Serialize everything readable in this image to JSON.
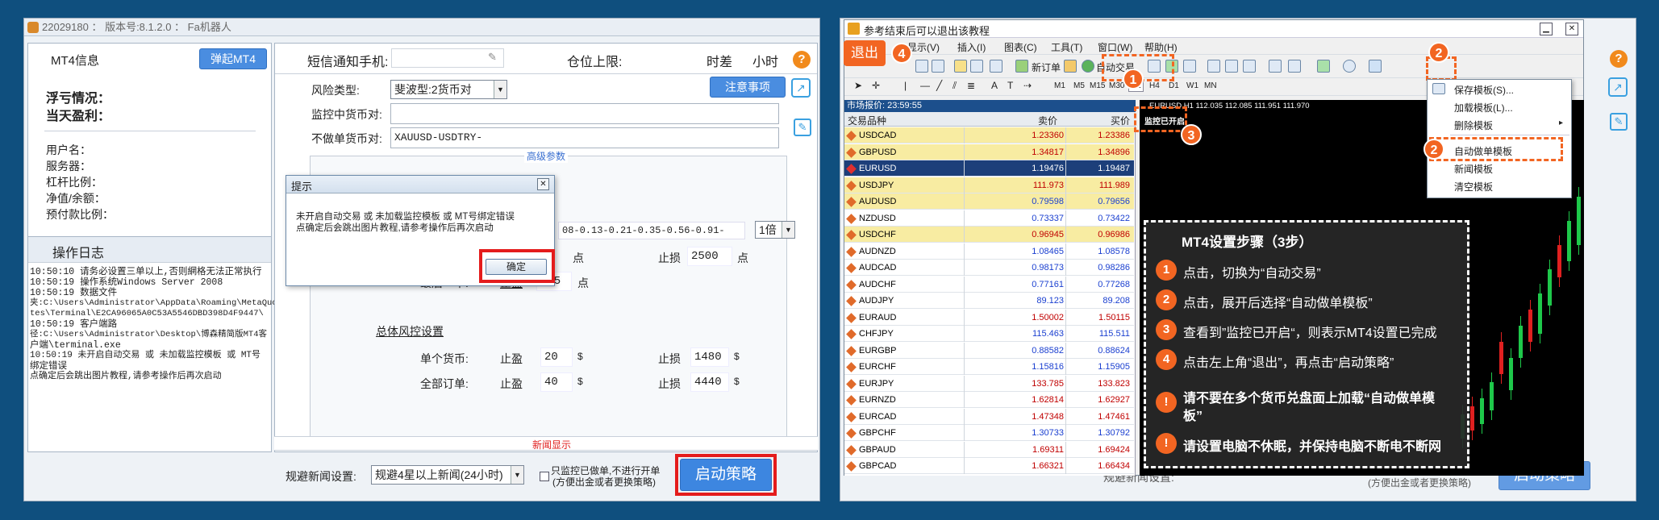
{
  "left": {
    "title_bar": "22029180 ： 版本号:8.1.2.0 ： Fa机器人",
    "mt4_info_label": "MT4信息",
    "open_mt4_button": "弹起MT4",
    "float_pl_label": "浮亏情况：",
    "daily_pl_label": "当天盈利：",
    "account_fields": [
      "用户名：",
      "服务器：",
      "杠杆比例：",
      "净值/余额：",
      "预付款比例："
    ],
    "log_title": "操作日志",
    "log_lines": [
      "10:50:10 请务必设置三单以上,否则網格无法正常执行",
      "10:50:19 操作系统Windows Server 2008",
      "10:50:19 数据文件",
      "夹:C:\\Users\\Administrator\\AppData\\Roaming\\MetaQuo",
      "tes\\Terminal\\E2CA96065A0C53A5546DBD398D4F9447\\",
      "10:50:19 客户端路",
      "径:C:\\Users\\Administrator\\Desktop\\博森精简版MT4客",
      "户端\\terminal.exe",
      "10:50:19 未开启自动交易 或 未加载监控模板 或 MT号",
      "绑定错误",
      "点确定后会跳出图片教程,请参考操作后再次启动"
    ],
    "sms_label": "短信通知手机:",
    "position_limit_label": "仓位上限:",
    "time_diff_label": "时差",
    "hour_label": "小时",
    "help_icon_text": "?",
    "risk_type_label": "风险类型:",
    "risk_type_value": "斐波型:2货币对",
    "notice_button": "注意事项",
    "monitor_pairs_label": "监控中货币对:",
    "exclude_pairs_label": "不做单货币对:",
    "exclude_pairs_value": "XAUUSD-USDTRY-",
    "advanced_label": "高级参数",
    "fib_value": "08-0.13-0.21-0.35-0.56-0.91-",
    "multiplier_value": "1倍",
    "stop_loss_label": "止损",
    "take_profit_label": "止盈",
    "points_unit": "点",
    "stop_loss_first": "2500",
    "last_order_label": "最后一单:",
    "last_order_tp": "335",
    "overall_risk_label": "总体风控设置",
    "single_currency_label": "单个货币:",
    "all_orders_label": "全部订单:",
    "single_tp": "20",
    "single_sl": "1480",
    "all_tp": "40",
    "all_sl": "4440",
    "dollar_unit": "$",
    "news_show": "新闻显示",
    "avoid_news_label": "规避新闻设置:",
    "avoid_news_value": "规避4星以上新闻(24小时)",
    "monitor_only_label": "只监控已做单,不进行开单",
    "monitor_only_sub": "(方便出金或者更换策略)",
    "start_button": "启动策略",
    "dialog": {
      "title": "提示",
      "message_line1": "未开启自动交易 或 未加载监控模板 或 MT号绑定错误",
      "message_line2": "点确定后会跳出图片教程,请参考操作后再次启动",
      "ok_button": "确定"
    }
  },
  "right": {
    "title_bar": "参考结束后可以退出该教程",
    "exit_button": "退出",
    "menu": [
      "显示(V)",
      "插入(I)",
      "图表(C)",
      "工具(T)",
      "窗口(W)",
      "帮助(H)"
    ],
    "new_order": "新订单",
    "auto_trade": "自动交易",
    "timeframes": [
      "M1",
      "M5",
      "M15",
      "M30",
      "H1",
      "H4",
      "D1",
      "W1",
      "MN"
    ],
    "market_watch_title": "市场报价: 23:59:55",
    "col_symbol": "交易品种",
    "col_bid": "卖价",
    "col_ask": "买价",
    "quotes": [
      {
        "s": "USDCAD",
        "b": "1.23360",
        "a": "1.23386",
        "hl": "y"
      },
      {
        "s": "GBPUSD",
        "b": "1.34817",
        "a": "1.34896",
        "hl": "y"
      },
      {
        "s": "EURUSD",
        "b": "1.19476",
        "a": "1.19487",
        "hl": "sel"
      },
      {
        "s": "USDJPY",
        "b": "111.973",
        "a": "111.989",
        "hl": "y"
      },
      {
        "s": "AUDUSD",
        "b": "0.79598",
        "a": "0.79656",
        "hl": "y",
        "c": "blue"
      },
      {
        "s": "NZDUSD",
        "b": "0.73337",
        "a": "0.73422",
        "hl": "w",
        "c": "blue"
      },
      {
        "s": "USDCHF",
        "b": "0.96945",
        "a": "0.96986",
        "hl": "y"
      },
      {
        "s": "AUDNZD",
        "b": "1.08465",
        "a": "1.08578",
        "hl": "w",
        "c": "blue"
      },
      {
        "s": "AUDCAD",
        "b": "0.98173",
        "a": "0.98286",
        "hl": "w",
        "c": "blue"
      },
      {
        "s": "AUDCHF",
        "b": "0.77161",
        "a": "0.77268",
        "hl": "w",
        "c": "blue"
      },
      {
        "s": "AUDJPY",
        "b": "89.123",
        "a": "89.208",
        "hl": "w",
        "c": "blue"
      },
      {
        "s": "EURAUD",
        "b": "1.50002",
        "a": "1.50115",
        "hl": "w"
      },
      {
        "s": "CHFJPY",
        "b": "115.463",
        "a": "115.511",
        "hl": "w",
        "c": "blue"
      },
      {
        "s": "EURGBP",
        "b": "0.88582",
        "a": "0.88624",
        "hl": "w",
        "c": "blue"
      },
      {
        "s": "EURCHF",
        "b": "1.15816",
        "a": "1.15905",
        "hl": "w",
        "c": "blue"
      },
      {
        "s": "EURJPY",
        "b": "133.785",
        "a": "133.823",
        "hl": "w"
      },
      {
        "s": "EURNZD",
        "b": "1.62814",
        "a": "1.62927",
        "hl": "w"
      },
      {
        "s": "EURCAD",
        "b": "1.47348",
        "a": "1.47461",
        "hl": "w"
      },
      {
        "s": "GBPCHF",
        "b": "1.30733",
        "a": "1.30792",
        "hl": "w",
        "c": "blue"
      },
      {
        "s": "GBPAUD",
        "b": "1.69311",
        "a": "1.69424",
        "hl": "w"
      },
      {
        "s": "GBPCAD",
        "b": "1.66321",
        "a": "1.66434",
        "hl": "w"
      }
    ],
    "chart_header": "EURUSD,H1  112.035 112.085 111.951 111.970",
    "monitor_started": "监控已开启",
    "dropdown": [
      "保存模板(S)...",
      "加载模板(L)...",
      "删除模板",
      "自动做单模板",
      "新闻模板",
      "清空模板"
    ],
    "guide_title": "MT4设置步骤（3步）",
    "guide_steps": [
      {
        "n": "1",
        "t": "点击，切换为“自动交易”"
      },
      {
        "n": "2",
        "t": "点击，展开后选择“自动做单模板”"
      },
      {
        "n": "3",
        "t": "查看到”监控已开启“，则表示MT4设置已完成"
      },
      {
        "n": "4",
        "t": "点击左上角“退出”，再点击“启动策略”"
      }
    ],
    "warn1_line1": "请不要在多个货币兑盘面上加载“自动做单模",
    "warn1_line2": "板”",
    "warn2": "请设置电脑不休眠，并保持电脑不断电不断网",
    "warn_mark": "!",
    "bottom_obscured": "规避新闻设置:",
    "bottom_obscured_sub": "(方便出金或者更换策略)",
    "bottom_start": "启动策略",
    "badges": [
      "1",
      "2",
      "2",
      "3",
      "4"
    ]
  }
}
